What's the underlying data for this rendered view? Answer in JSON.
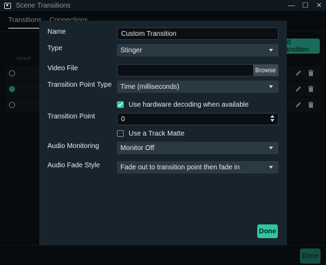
{
  "window": {
    "title": "Scene Transitions",
    "controls": {
      "minimize": "—",
      "maximize": "☐",
      "close": "✕"
    }
  },
  "background": {
    "tabs": [
      {
        "label": "Transitions",
        "active": true
      },
      {
        "label": "Connections",
        "active": false
      }
    ],
    "add_button_label": "Add Transition",
    "column_header": "default",
    "rows": [
      {
        "selected": false
      },
      {
        "selected": true
      },
      {
        "selected": false
      }
    ],
    "done_label": "Done"
  },
  "modal": {
    "name": {
      "label": "Name",
      "value": "Custom Transition"
    },
    "type": {
      "label": "Type",
      "value": "Stinger"
    },
    "video_file": {
      "label": "Video File",
      "value": "",
      "browse_label": "Browse"
    },
    "transition_point_type": {
      "label": "Transition Point Type",
      "value": "Time (milliseconds)"
    },
    "hardware_decoding": {
      "label": "Use hardware decoding when available",
      "checked": true
    },
    "transition_point": {
      "label": "Transition Point",
      "value": "0"
    },
    "track_matte": {
      "label": "Use a Track Matte",
      "checked": false
    },
    "audio_monitoring": {
      "label": "Audio Monitoring",
      "value": "Monitor Off"
    },
    "audio_fade_style": {
      "label": "Audio Fade Style",
      "value": "Fade out to transition point then fade in"
    },
    "done_label": "Done"
  },
  "colors": {
    "accent": "#31c3a2",
    "modal_bg": "#17242d",
    "input_bg": "#0a0f13",
    "select_bg": "#2b3942"
  }
}
